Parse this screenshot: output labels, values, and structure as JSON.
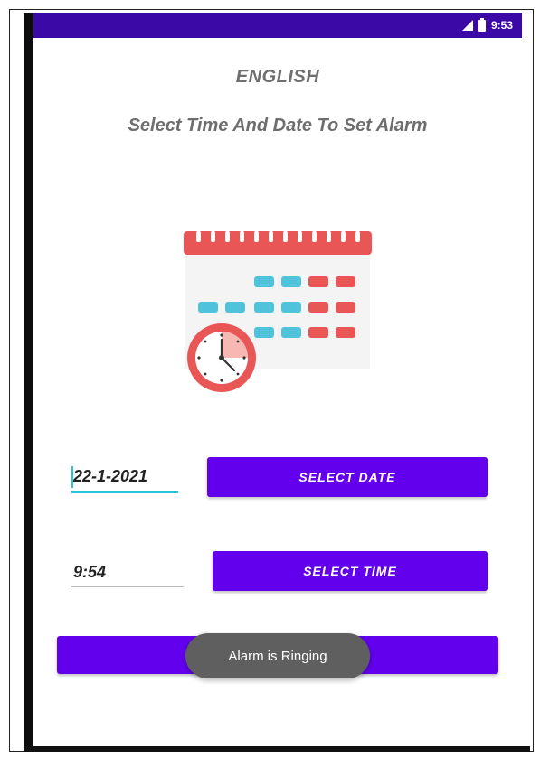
{
  "status_bar": {
    "time": "9:53",
    "signal_icon": "signal-icon",
    "battery_icon": "battery-icon"
  },
  "header": {
    "app_title": "ENGLISH",
    "subtitle": "Select Time And Date To Set Alarm"
  },
  "illustration": {
    "icon": "calendar-clock-icon"
  },
  "date_row": {
    "value": "22-1-2021",
    "button_label": "SELECT DATE"
  },
  "time_row": {
    "value": "9:54",
    "button_label": "SELECT TIME"
  },
  "set_alarm_button": {
    "label": ""
  },
  "toast": {
    "text": "Alarm is Ringing"
  },
  "colors": {
    "status_bar": "#3b0aa6",
    "primary": "#6200ee",
    "accent": "#26c6da",
    "calendar_red": "#e85656",
    "calendar_cyan": "#4fc3dc",
    "toast_bg": "#5f5f5f"
  }
}
